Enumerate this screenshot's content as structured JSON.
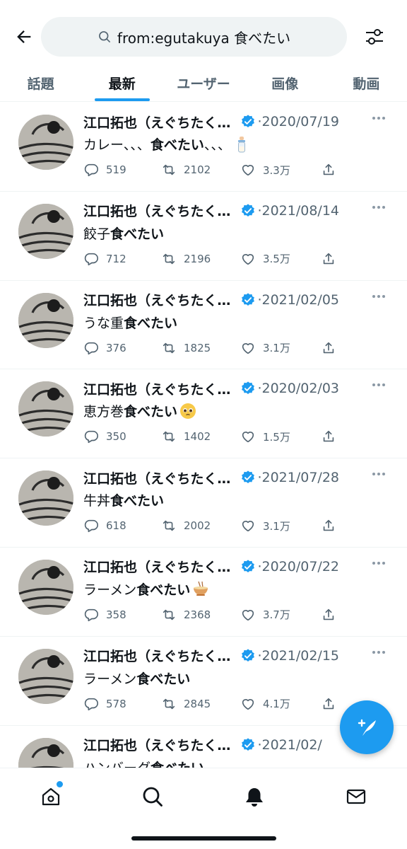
{
  "search": {
    "query": "from:egutakuya 食べたい"
  },
  "tabs": [
    {
      "label": "話題",
      "active": false
    },
    {
      "label": "最新",
      "active": true
    },
    {
      "label": "ユーザー",
      "active": false
    },
    {
      "label": "画像",
      "active": false
    },
    {
      "label": "動画",
      "active": false
    }
  ],
  "tweets": [
    {
      "name": "江口拓也（えぐちたく…",
      "date": "2020/07/19",
      "text_pre": "カレー、、、",
      "text_bold": "食べたい",
      "text_post": "、、、",
      "emoji": "baby-bottle-emoji",
      "replies": "519",
      "retweets": "2102",
      "likes": "3.3万"
    },
    {
      "name": "江口拓也（えぐちたく…",
      "date": "2021/08/14",
      "text_pre": "餃子",
      "text_bold": "食べたい",
      "text_post": "",
      "emoji": "",
      "replies": "712",
      "retweets": "2196",
      "likes": "3.5万"
    },
    {
      "name": "江口拓也（えぐちたく…",
      "date": "2021/02/05",
      "text_pre": "うな重",
      "text_bold": "食べたい",
      "text_post": "",
      "emoji": "",
      "replies": "376",
      "retweets": "1825",
      "likes": "3.1万"
    },
    {
      "name": "江口拓也（えぐちたく…",
      "date": "2020/02/03",
      "text_pre": "恵方巻",
      "text_bold": "食べたい",
      "text_post": "",
      "emoji": "pleading-face-emoji",
      "replies": "350",
      "retweets": "1402",
      "likes": "1.5万"
    },
    {
      "name": "江口拓也（えぐちたく…",
      "date": "2021/07/28",
      "text_pre": "牛丼",
      "text_bold": "食べたい",
      "text_post": "",
      "emoji": "",
      "replies": "618",
      "retweets": "2002",
      "likes": "3.1万"
    },
    {
      "name": "江口拓也（えぐちたく…",
      "date": "2020/07/22",
      "text_pre": "ラーメン",
      "text_bold": "食べたい",
      "text_post": "",
      "emoji": "ramen-bowl-emoji",
      "replies": "358",
      "retweets": "2368",
      "likes": "3.7万"
    },
    {
      "name": "江口拓也（えぐちたく…",
      "date": "2021/02/15",
      "text_pre": "ラーメン",
      "text_bold": "食べたい",
      "text_post": "",
      "emoji": "",
      "replies": "578",
      "retweets": "2845",
      "likes": "4.1万"
    },
    {
      "name": "江口拓也（えぐちたく…",
      "date": "2021/02/",
      "text_pre": "ハンバーグ",
      "text_bold": "食べたい",
      "text_post": "",
      "emoji": "",
      "replies": "",
      "retweets": "",
      "likes": ""
    }
  ],
  "colors": {
    "accent": "#1d9bf0",
    "text": "#0f1419",
    "muted": "#536471",
    "pill": "#eff3f4"
  }
}
